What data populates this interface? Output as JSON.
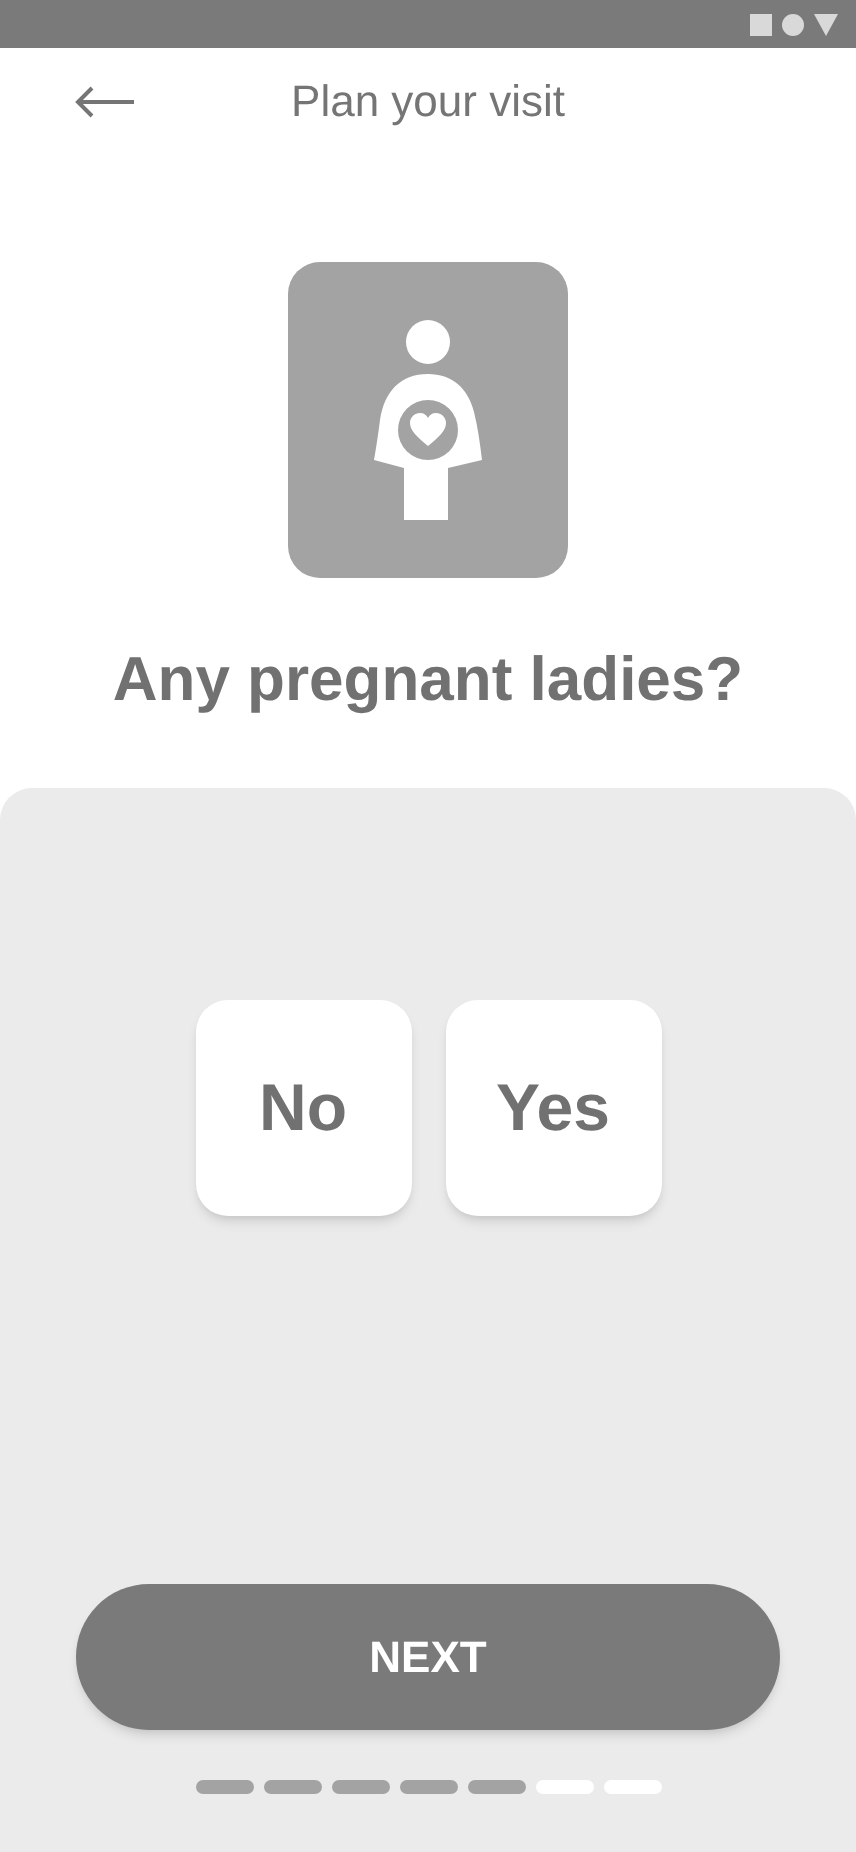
{
  "header": {
    "title": "Plan your visit"
  },
  "question": "Any pregnant ladies?",
  "options": [
    {
      "label": "No"
    },
    {
      "label": "Yes"
    }
  ],
  "next_button": "NEXT",
  "progress": [
    {
      "completed": true
    },
    {
      "completed": true
    },
    {
      "completed": true
    },
    {
      "completed": true
    },
    {
      "completed": true
    },
    {
      "completed": false
    },
    {
      "completed": false
    }
  ]
}
